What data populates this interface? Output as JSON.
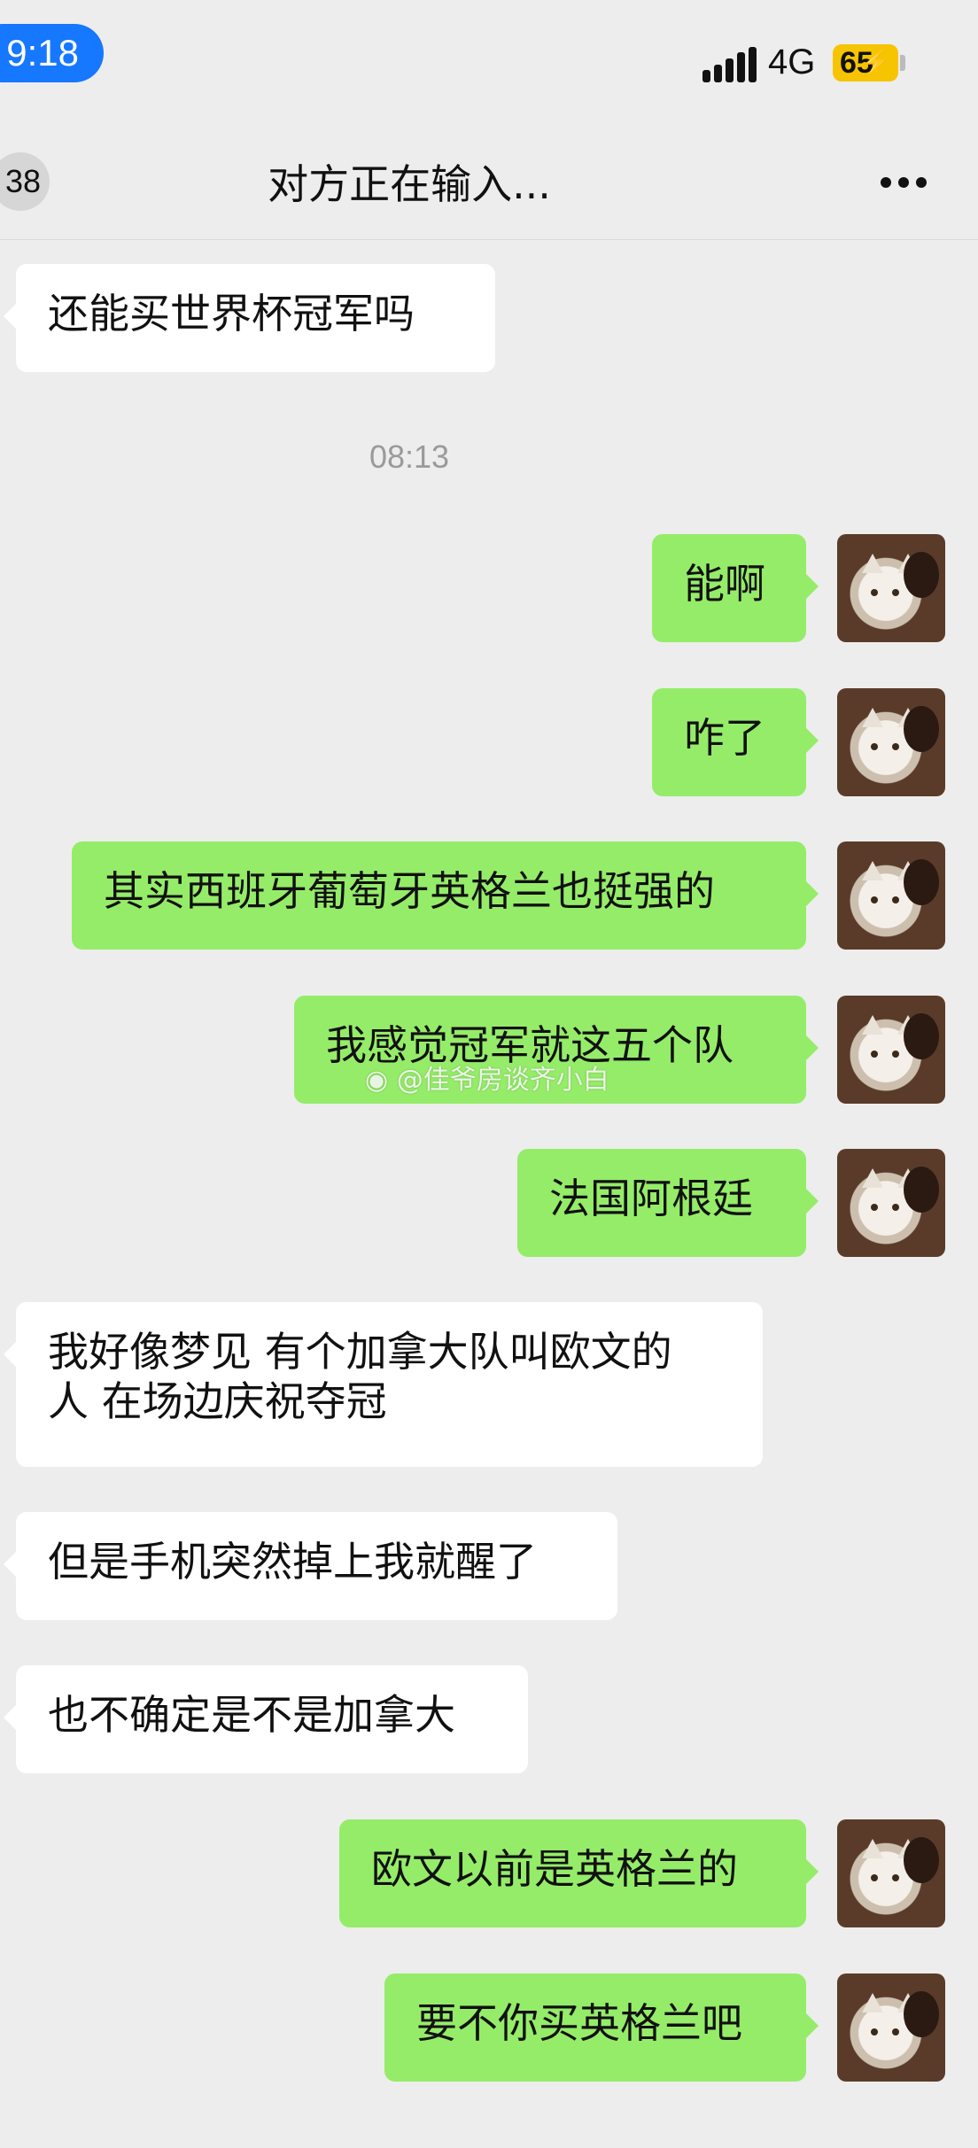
{
  "status_bar": {
    "time": "9:18",
    "network": "4G",
    "battery": "65",
    "battery_color": "#f6c400",
    "time_pill_color": "#1677ff"
  },
  "nav": {
    "back_count": "38",
    "title": "对方正在输入...",
    "more_icon": "more-dots-icon"
  },
  "timestamp": "08:13",
  "messages": [
    {
      "side": "in",
      "text": "还能买世界杯冠军吗"
    },
    {
      "side": "out",
      "text": "能啊"
    },
    {
      "side": "out",
      "text": "咋了"
    },
    {
      "side": "out",
      "text": "其实西班牙葡萄牙英格兰也挺强的"
    },
    {
      "side": "out",
      "text": "我感觉冠军就这五个队"
    },
    {
      "side": "out",
      "text": "法国阿根廷"
    },
    {
      "side": "in",
      "text_line1": "我好像梦见 有个加拿大队叫欧文的",
      "text_line2": "人 在场边庆祝夺冠"
    },
    {
      "side": "in",
      "text": "但是手机突然掉上我就醒了"
    },
    {
      "side": "in",
      "text": "也不确定是不是加拿大"
    },
    {
      "side": "out",
      "text": "欧文以前是英格兰的"
    },
    {
      "side": "out",
      "text": "要不你买英格兰吧"
    }
  ],
  "watermark": "@佳爷房谈齐小白",
  "colors": {
    "chat_background": "#ededed",
    "outgoing_bubble": "#95ec69",
    "incoming_bubble": "#ffffff"
  }
}
